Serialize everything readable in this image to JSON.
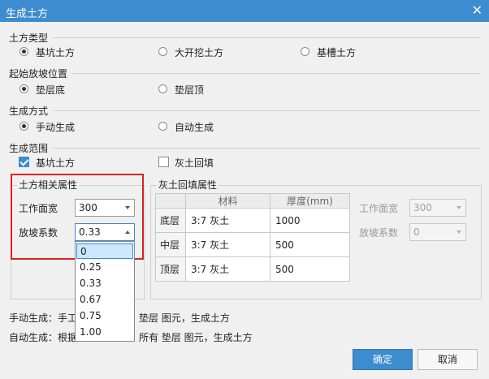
{
  "dialog": {
    "title": "生成土方"
  },
  "earthwork_type": {
    "label": "土方类型",
    "options": [
      "基坑土方",
      "大开挖土方",
      "基槽土方"
    ],
    "selected_index": 0
  },
  "slope_start": {
    "label": "起始放坡位置",
    "options": [
      "垫层底",
      "垫层顶"
    ],
    "selected_index": 0
  },
  "gen_mode": {
    "label": "生成方式",
    "options": [
      "手动生成",
      "自动生成"
    ],
    "selected_index": 0
  },
  "gen_scope": {
    "label": "生成范围",
    "items": [
      {
        "label": "基坑土方",
        "checked": true
      },
      {
        "label": "灰土回填",
        "checked": false
      }
    ]
  },
  "earth_props": {
    "title": "土方相关属性",
    "work_width_label": "工作面宽",
    "work_width_value": "300",
    "slope_label": "放坡系数",
    "slope_value": "0.33",
    "slope_options": [
      "0",
      "0.25",
      "0.33",
      "0.67",
      "0.75",
      "1.00"
    ],
    "highlighted_option": "0"
  },
  "fill_props": {
    "title": "灰土回填属性",
    "headers": [
      "",
      "材料",
      "厚度(mm)"
    ],
    "rows": [
      {
        "name": "底层",
        "material": "3:7 灰土",
        "thickness": "1000"
      },
      {
        "name": "中层",
        "material": "3:7 灰土",
        "thickness": "500"
      },
      {
        "name": "顶层",
        "material": "3:7 灰土",
        "thickness": "500"
      }
    ],
    "work_width_label": "工作面宽",
    "work_width_value": "300",
    "slope_label": "放坡系数",
    "slope_value": "0"
  },
  "descriptions": {
    "manual_a": "手动生成：手工",
    "manual_b": "垫层 图元，生成土方",
    "auto_a": "自动生成：根据",
    "auto_b": "所有 垫层 图元，生成土方"
  },
  "buttons": {
    "ok": "确定",
    "cancel": "取消"
  },
  "colors": {
    "accent": "#3c8ccf",
    "highlight_box": "#e02020"
  }
}
